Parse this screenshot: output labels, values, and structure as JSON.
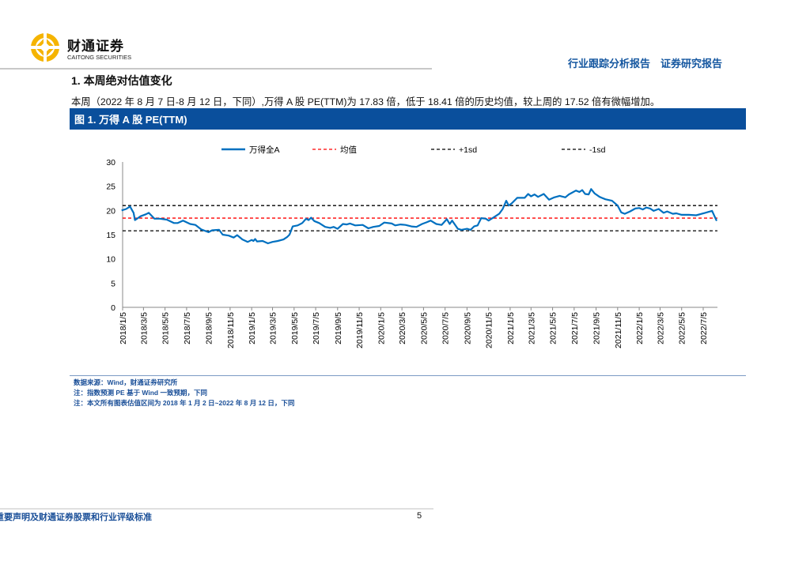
{
  "header": {
    "logo_cn": "财通证券",
    "logo_en": "CAITONG SECURITIES",
    "right_title": "行业跟踪分析报告　证券研究报告"
  },
  "section": {
    "heading": "1.  本周绝对估值变化",
    "paragraph": "本周（2022 年 8 月 7 日-8 月 12 日，下同）,万得 A 股 PE(TTM)为 17.83 倍，低于 18.41 倍的历史均值，较上周的 17.52 倍有微幅增加。"
  },
  "figure": {
    "title": "图 1. 万得 A 股 PE(TTM)"
  },
  "notes": [
    "数据来源：Wind，财通证券研究所",
    "注：指数预测 PE 基于 Wind 一致预期，下同",
    "注：本文所有图表估值区间为 2018 年 1 月 2 日~2022 年 8 月 12 日，下同"
  ],
  "footer": {
    "text": "重要声明及财通证券股票和行业评级标准",
    "page": "5"
  },
  "colors": {
    "series": "#0070c0",
    "mean": "#ff0000",
    "sd": "#000000",
    "brand": "#0a4f9c",
    "logo": "#f5b400"
  },
  "chart_data": {
    "type": "line",
    "title": "",
    "xlabel": "",
    "ylabel": "",
    "ylim": [
      0,
      30
    ],
    "yticks": [
      0,
      5,
      10,
      15,
      20,
      25,
      30
    ],
    "xticks": [
      "2018/1/5",
      "2018/3/5",
      "2018/5/5",
      "2018/7/5",
      "2018/9/5",
      "2018/11/5",
      "2019/1/5",
      "2019/3/5",
      "2019/5/5",
      "2019/7/5",
      "2019/9/5",
      "2019/11/5",
      "2020/1/5",
      "2020/3/5",
      "2020/5/5",
      "2020/7/5",
      "2020/9/5",
      "2020/11/5",
      "2021/1/5",
      "2021/3/5",
      "2021/5/5",
      "2021/7/5",
      "2021/9/5",
      "2021/11/5",
      "2022/1/5",
      "2022/3/5",
      "2022/5/5",
      "2022/7/5"
    ],
    "legend": [
      "万得全A",
      "均值",
      "+1sd",
      "-1sd"
    ],
    "legend_position": "top",
    "mean": 18.41,
    "plus_1sd": 21.0,
    "minus_1sd": 15.8,
    "series": [
      {
        "name": "万得全A",
        "points": [
          [
            "2018/1/2",
            20.0
          ],
          [
            "2018/1/15",
            20.3
          ],
          [
            "2018/1/26",
            20.8
          ],
          [
            "2018/2/5",
            19.5
          ],
          [
            "2018/2/9",
            18.0
          ],
          [
            "2018/2/25",
            18.8
          ],
          [
            "2018/3/12",
            19.2
          ],
          [
            "2018/3/20",
            19.5
          ],
          [
            "2018/4/5",
            18.3
          ],
          [
            "2018/4/20",
            18.3
          ],
          [
            "2018/5/10",
            18.1
          ],
          [
            "2018/5/30",
            17.4
          ],
          [
            "2018/6/10",
            17.4
          ],
          [
            "2018/6/25",
            17.9
          ],
          [
            "2018/7/15",
            17.2
          ],
          [
            "2018/7/30",
            17.0
          ],
          [
            "2018/8/15",
            16.1
          ],
          [
            "2018/9/5",
            15.5
          ],
          [
            "2018/9/15",
            15.9
          ],
          [
            "2018/10/5",
            16.0
          ],
          [
            "2018/10/15",
            15.0
          ],
          [
            "2018/11/1",
            14.8
          ],
          [
            "2018/11/15",
            14.4
          ],
          [
            "2018/11/25",
            14.9
          ],
          [
            "2018/12/10",
            14.0
          ],
          [
            "2018/12/25",
            13.5
          ],
          [
            "2019/1/5",
            13.9
          ],
          [
            "2019/1/10",
            13.7
          ],
          [
            "2019/1/15",
            14.1
          ],
          [
            "2019/1/20",
            13.6
          ],
          [
            "2019/2/5",
            13.7
          ],
          [
            "2019/2/20",
            13.2
          ],
          [
            "2019/3/5",
            13.5
          ],
          [
            "2019/3/20",
            13.7
          ],
          [
            "2019/4/5",
            14.0
          ],
          [
            "2019/4/15",
            14.5
          ],
          [
            "2019/4/22",
            15.0
          ],
          [
            "2019/5/1",
            16.7
          ],
          [
            "2019/5/15",
            16.9
          ],
          [
            "2019/5/28",
            17.4
          ],
          [
            "2019/6/8",
            18.3
          ],
          [
            "2019/6/15",
            18.0
          ],
          [
            "2019/6/22",
            18.5
          ],
          [
            "2019/7/1",
            17.8
          ],
          [
            "2019/7/15",
            17.4
          ],
          [
            "2019/8/1",
            16.6
          ],
          [
            "2019/8/15",
            16.4
          ],
          [
            "2019/8/25",
            16.6
          ],
          [
            "2019/9/5",
            16.2
          ],
          [
            "2019/9/20",
            17.2
          ],
          [
            "2019/10/1",
            17.1
          ],
          [
            "2019/10/10",
            17.3
          ],
          [
            "2019/10/25",
            16.9
          ],
          [
            "2019/11/15",
            17.0
          ],
          [
            "2019/12/1",
            16.3
          ],
          [
            "2019/12/15",
            16.6
          ],
          [
            "2020/1/1",
            16.8
          ],
          [
            "2020/1/15",
            17.5
          ],
          [
            "2020/2/5",
            17.3
          ],
          [
            "2020/2/15",
            16.9
          ],
          [
            "2020/3/1",
            17.1
          ],
          [
            "2020/3/15",
            17.0
          ],
          [
            "2020/4/1",
            16.7
          ],
          [
            "2020/4/15",
            16.6
          ],
          [
            "2020/5/1",
            17.2
          ],
          [
            "2020/5/15",
            17.6
          ],
          [
            "2020/5/25",
            17.9
          ],
          [
            "2020/6/10",
            17.2
          ],
          [
            "2020/6/25",
            17.0
          ],
          [
            "2020/7/10",
            18.2
          ],
          [
            "2020/7/18",
            17.2
          ],
          [
            "2020/7/25",
            17.9
          ],
          [
            "2020/8/10",
            16.2
          ],
          [
            "2020/8/20",
            16.0
          ],
          [
            "2020/9/5",
            16.2
          ],
          [
            "2020/9/15",
            16.0
          ],
          [
            "2020/9/25",
            16.7
          ],
          [
            "2020/10/5",
            16.9
          ],
          [
            "2020/10/15",
            18.4
          ],
          [
            "2020/10/28",
            18.3
          ],
          [
            "2020/11/5",
            17.9
          ],
          [
            "2020/11/20",
            18.6
          ],
          [
            "2020/12/5",
            19.3
          ],
          [
            "2020/12/15",
            20.3
          ],
          [
            "2020/12/25",
            22.0
          ],
          [
            "2021/1/1",
            21.0
          ],
          [
            "2021/1/10",
            21.5
          ],
          [
            "2021/1/25",
            22.6
          ],
          [
            "2021/2/15",
            22.6
          ],
          [
            "2021/2/25",
            23.4
          ],
          [
            "2021/3/5",
            22.9
          ],
          [
            "2021/3/15",
            23.3
          ],
          [
            "2021/3/25",
            22.8
          ],
          [
            "2021/4/10",
            23.4
          ],
          [
            "2021/4/25",
            22.2
          ],
          [
            "2021/5/10",
            22.7
          ],
          [
            "2021/5/25",
            23.0
          ],
          [
            "2021/6/10",
            22.7
          ],
          [
            "2021/6/20",
            23.3
          ],
          [
            "2021/7/10",
            24.1
          ],
          [
            "2021/7/20",
            23.8
          ],
          [
            "2021/7/28",
            24.2
          ],
          [
            "2021/8/5",
            23.4
          ],
          [
            "2021/8/15",
            23.3
          ],
          [
            "2021/8/22",
            24.4
          ],
          [
            "2021/9/1",
            23.5
          ],
          [
            "2021/9/15",
            22.8
          ],
          [
            "2021/10/1",
            22.3
          ],
          [
            "2021/10/20",
            22.0
          ],
          [
            "2021/11/5",
            21.0
          ],
          [
            "2021/11/15",
            19.6
          ],
          [
            "2021/11/25",
            19.3
          ],
          [
            "2021/12/10",
            19.8
          ],
          [
            "2021/12/25",
            20.4
          ],
          [
            "2022/1/5",
            20.5
          ],
          [
            "2022/1/15",
            20.2
          ],
          [
            "2022/1/25",
            20.6
          ],
          [
            "2022/2/5",
            20.4
          ],
          [
            "2022/2/15",
            19.9
          ],
          [
            "2022/3/1",
            20.3
          ],
          [
            "2022/3/15",
            19.5
          ],
          [
            "2022/3/25",
            19.8
          ],
          [
            "2022/4/10",
            19.3
          ],
          [
            "2022/4/20",
            19.4
          ],
          [
            "2022/5/5",
            19.1
          ],
          [
            "2022/5/25",
            19.1
          ],
          [
            "2022/6/15",
            19.0
          ],
          [
            "2022/7/1",
            19.3
          ],
          [
            "2022/7/20",
            19.7
          ],
          [
            "2022/7/30",
            19.9
          ],
          [
            "2022/8/12",
            17.83
          ]
        ]
      }
    ]
  }
}
